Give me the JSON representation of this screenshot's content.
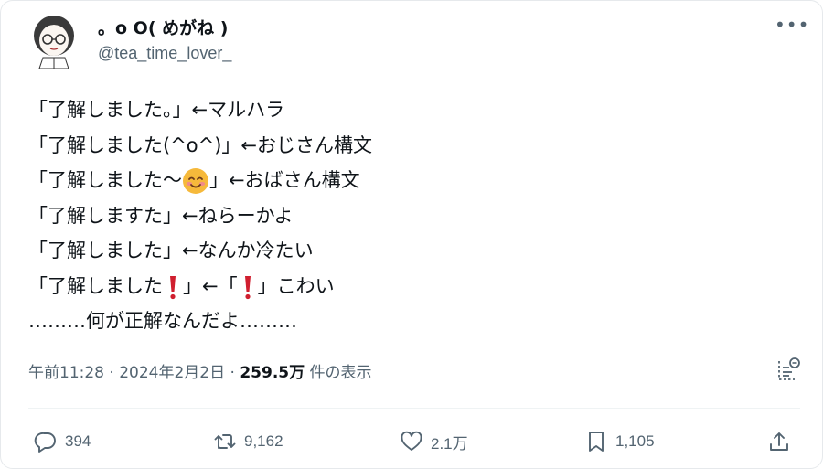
{
  "author": {
    "display_name": "。o O( めがね )",
    "handle": "@tea_time_lover_"
  },
  "more_icon": "more-horizontal-icon",
  "post": {
    "lines": [
      "「了解しました。」←マルハラ",
      "「了解しました(^o^)」←おじさん構文",
      {
        "before": "「了解しました〜",
        "emoji": "smiling-face-emoji",
        "after": "」←おばさん構文"
      },
      "「了解しますた」←ねらーかよ",
      "「了解しました」←なんか冷たい",
      {
        "before": "「了解しました",
        "emoji": "exclamation-emoji",
        "middle": "」←「",
        "emoji2": "exclamation-emoji",
        "after": "」こわい"
      },
      "………何が正解なんだよ………"
    ]
  },
  "meta": {
    "time": "午前11:28",
    "separator": " · ",
    "date": "2024年2月2日",
    "views_count": "259.5万",
    "views_label": " 件の表示"
  },
  "actions": {
    "replies": "394",
    "reposts": "9,162",
    "likes": "2.1万",
    "bookmarks": "1,105"
  },
  "colors": {
    "text": "#0f1419",
    "secondary": "#536471",
    "divider": "#eff3f4",
    "exclamation": "#d01f2f",
    "emoji_face": "#f6b93b"
  }
}
